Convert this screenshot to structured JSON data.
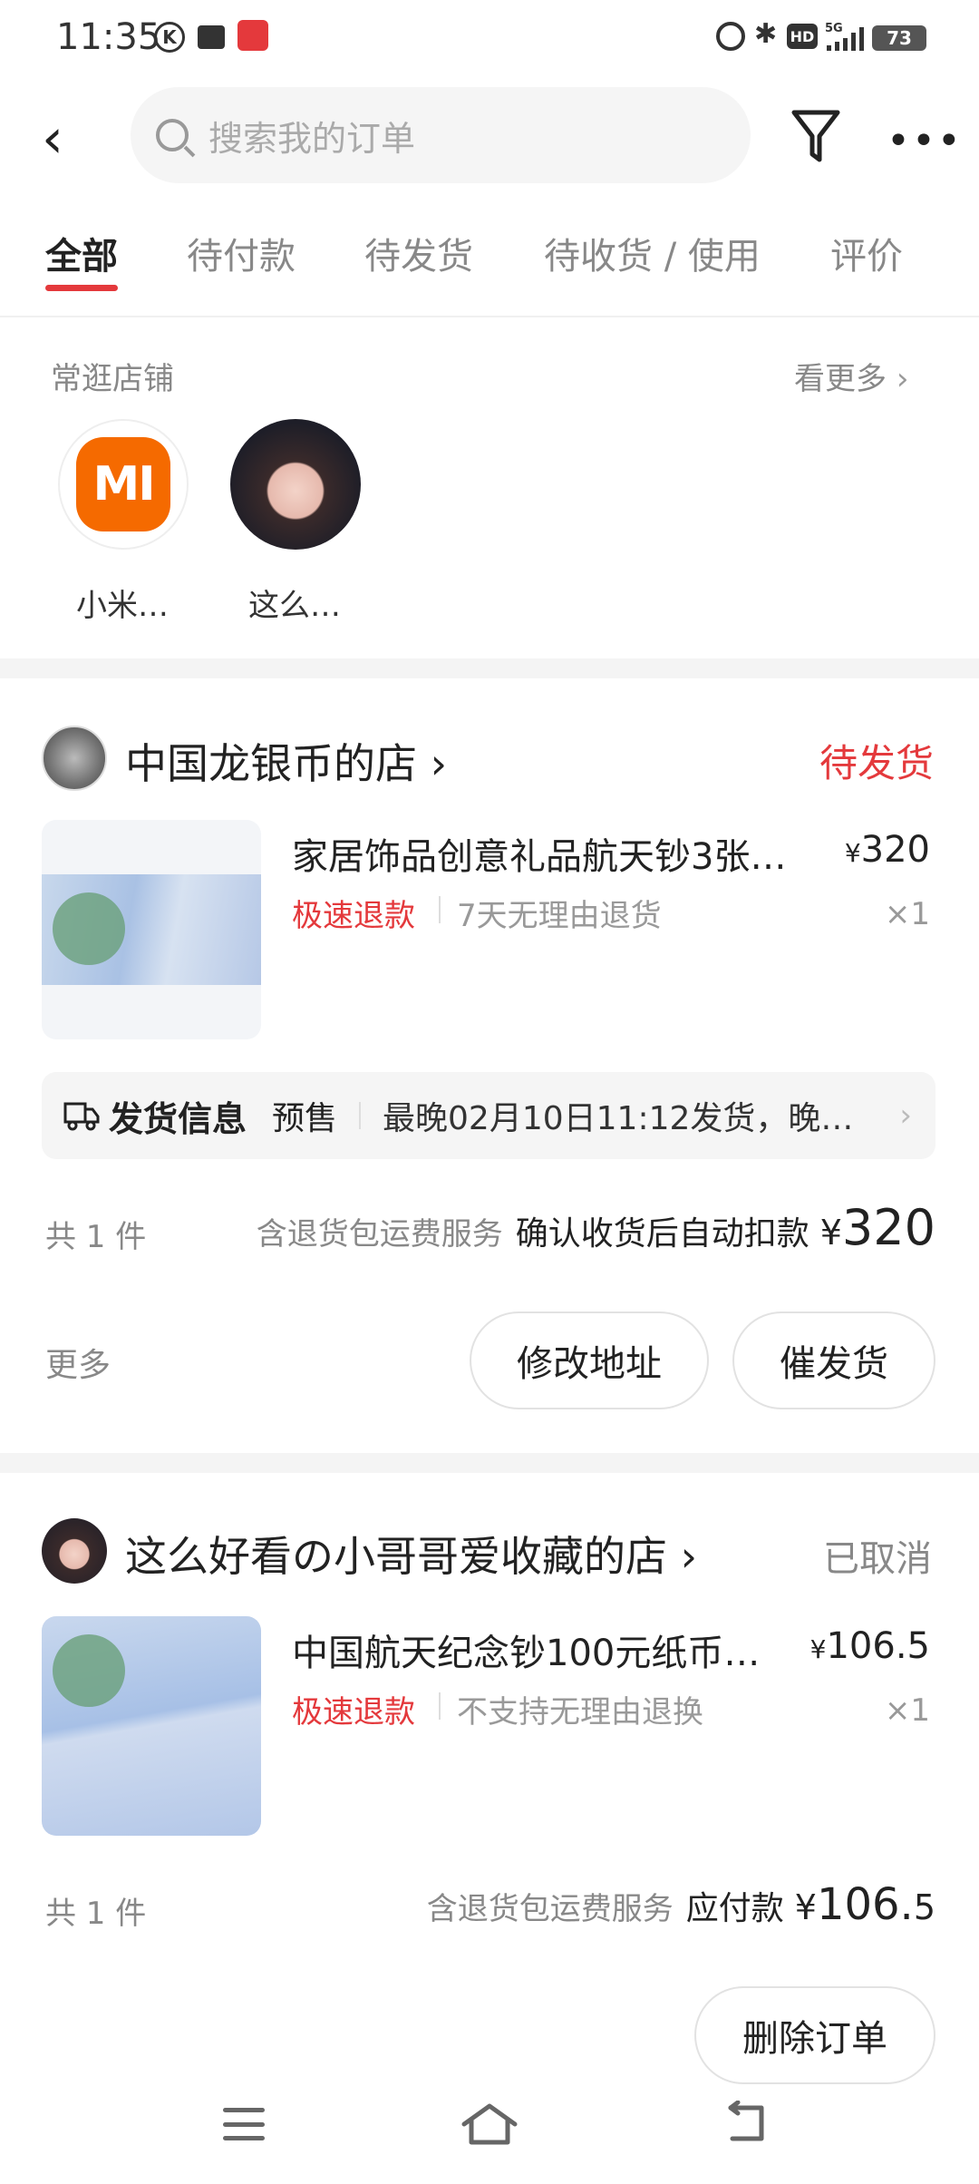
{
  "status_bar": {
    "time": "11:35",
    "signal": "5G",
    "hd": "HD",
    "battery": "73"
  },
  "search": {
    "placeholder": "搜索我的订单"
  },
  "tabs": [
    {
      "label": "全部",
      "active": true
    },
    {
      "label": "待付款"
    },
    {
      "label": "待发货"
    },
    {
      "label": "待收货 / 使用"
    },
    {
      "label": "评价"
    }
  ],
  "frequent": {
    "title": "常逛店铺",
    "more": "看更多",
    "stores": [
      {
        "name": "小米…",
        "logo_text": "MI",
        "color": "#f56a00"
      },
      {
        "name": "这么…"
      }
    ]
  },
  "orders": [
    {
      "shop": "中国龙银币的店",
      "status": "待发货",
      "product_title": "家居饰品创意礼品航天钞3张…",
      "price_yen": "¥",
      "price": "320",
      "qty": "×1",
      "tag_red": "极速退款",
      "tag_gray": "7天无理由退货",
      "shipping": {
        "label": "发货信息",
        "pre": "预售",
        "detail": "最晚02月10日11:12发货，晚…"
      },
      "count": "共 1 件",
      "service": "含退货包运费服务",
      "pay_label": "确认收货后自动扣款",
      "total_yen": "¥",
      "total": "320",
      "more": "更多",
      "buttons": [
        "修改地址",
        "催发货"
      ]
    },
    {
      "shop": "这么好看の小哥哥爱收藏的店",
      "status": "已取消",
      "product_title": "中国航天纪念钞100元纸币…",
      "price_yen": "¥",
      "price": "106.5",
      "qty": "×1",
      "tag_red": "极速退款",
      "tag_gray": "不支持无理由退换",
      "count": "共 1 件",
      "service": "含退货包运费服务",
      "pay_label": "应付款",
      "total_yen": "¥",
      "total_int": "106.",
      "total_dec": "5",
      "buttons": [
        "删除订单"
      ]
    }
  ],
  "colors": {
    "accent": "#e4393c",
    "mi_orange": "#f56a00"
  }
}
